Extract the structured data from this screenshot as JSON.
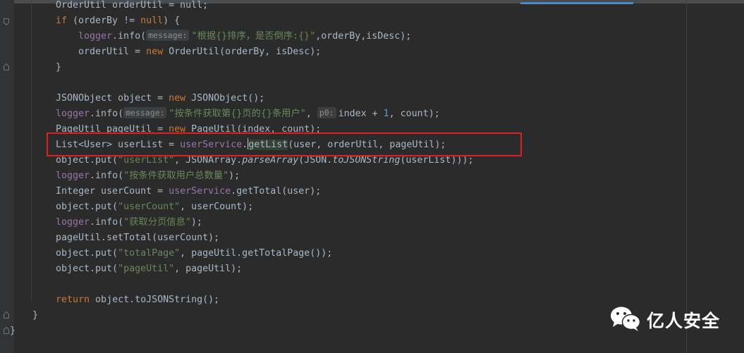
{
  "code": {
    "line0": "OrderUtil orderUtil = null;",
    "l1_if": "if",
    "l1_cond": " (orderBy != ",
    "l1_null": "null",
    "l1_brace": ") {",
    "l2_logger": "logger",
    "l2_info": ".info(",
    "l2_hint": "message:",
    "l2_str": "\"根据{}排序，是否倒序:{}\"",
    "l2_rest": ",orderBy,isDesc);",
    "l3_a": "orderUtil = ",
    "l3_new": "new",
    "l3_b": " OrderUtil(orderBy, isDesc);",
    "l4": "}",
    "l6_a": "JSONObject object = ",
    "l6_new": "new",
    "l6_b": " JSONObject();",
    "l7_logger": "logger",
    "l7_info": ".info(",
    "l7_hint1": "message:",
    "l7_str": "\"按条件获取第{}页的{}条用户\"",
    "l7_comma": ", ",
    "l7_hint2": "p0:",
    "l7_a": "index + ",
    "l7_num": "1",
    "l7_b": ", count);",
    "l8_a": "PageUtil pageUtil = ",
    "l8_new": "new",
    "l8_b": " PageUtil(index, count);",
    "l9_a": "List<User> userList = ",
    "l9_svc": "userService",
    "l9_dot": ".",
    "l9_method": "getList",
    "l9_b": "(user, orderUtil, pageUtil);",
    "l10_a": "object.put(",
    "l10_str": "\"userList\"",
    "l10_b": ", JSONArray.",
    "l10_parse": "parseArray",
    "l10_c": "(JSON.",
    "l10_tojson": "toJSONString",
    "l10_d": "(userList)));",
    "l11_logger": "logger",
    "l11_info": ".info(",
    "l11_str": "\"按条件获取用户总数量\"",
    "l11_end": ");",
    "l12_a": "Integer userCount = ",
    "l12_svc": "userService",
    "l12_b": ".getTotal(user);",
    "l13_a": "object.put(",
    "l13_str": "\"userCount\"",
    "l13_b": ", userCount);",
    "l14_logger": "logger",
    "l14_info": ".info(",
    "l14_str": "\"获取分页信息\"",
    "l14_end": ");",
    "l15": "pageUtil.setTotal(userCount);",
    "l16_a": "object.put(",
    "l16_str": "\"totalPage\"",
    "l16_b": ", pageUtil.getTotalPage());",
    "l17_a": "object.put(",
    "l17_str": "\"pageUtil\"",
    "l17_b": ", pageUtil);",
    "l19_ret": "return",
    "l19_b": " object.toJSONString();",
    "l20": "}",
    "l21": "}"
  },
  "watermark": {
    "text": "亿人安全",
    "icon": "wechat-icon"
  },
  "colors": {
    "background": "#2b2b2b",
    "keyword": "#cc7832",
    "string": "#6a8759",
    "field": "#9876aa",
    "highlight_box": "#e02020"
  }
}
